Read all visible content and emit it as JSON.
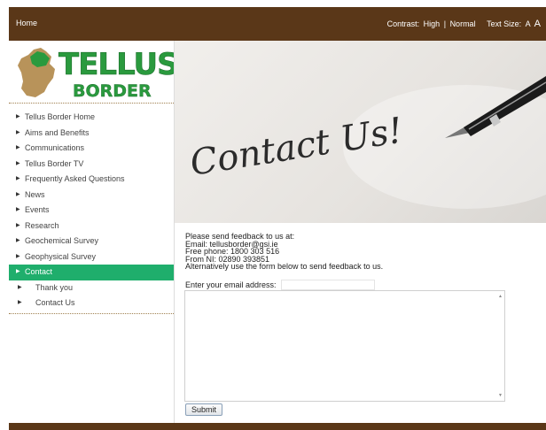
{
  "header": {
    "home_label": "Home",
    "contrast_label": "Contrast:",
    "contrast_high": "High",
    "contrast_separator": "|",
    "contrast_normal": "Normal",
    "text_size_label": "Text Size:",
    "text_size_small": "A",
    "text_size_large": "A"
  },
  "logo": {
    "line1": "TELLUS",
    "line2": "BORDER"
  },
  "nav": {
    "items": [
      {
        "label": "Tellus Border Home"
      },
      {
        "label": "Aims and Benefits"
      },
      {
        "label": "Communications"
      },
      {
        "label": "Tellus Border TV"
      },
      {
        "label": "Frequently Asked Questions"
      },
      {
        "label": "News"
      },
      {
        "label": "Events"
      },
      {
        "label": "Research"
      },
      {
        "label": "Geochemical Survey"
      },
      {
        "label": "Geophysical Survey"
      },
      {
        "label": "Contact"
      },
      {
        "label": "Thank you"
      },
      {
        "label": "Contact Us"
      }
    ]
  },
  "banner": {
    "text": "Contact Us!"
  },
  "content": {
    "line1": "Please send feedback to us at:",
    "line2": "Email: tellusborder@gsi.ie",
    "line3": "Free phone: 1800 303 516",
    "line4": "From NI: 02890 393851",
    "line5": "Alternatively use the form below to send feedback to us.",
    "email_label": "Enter your email address:",
    "email_value": "",
    "message_value": "",
    "submit_label": "Submit"
  },
  "colors": {
    "brand_brown": "#5a3718",
    "active_green": "#1fae6c",
    "logo_green": "#2a9a3e"
  }
}
